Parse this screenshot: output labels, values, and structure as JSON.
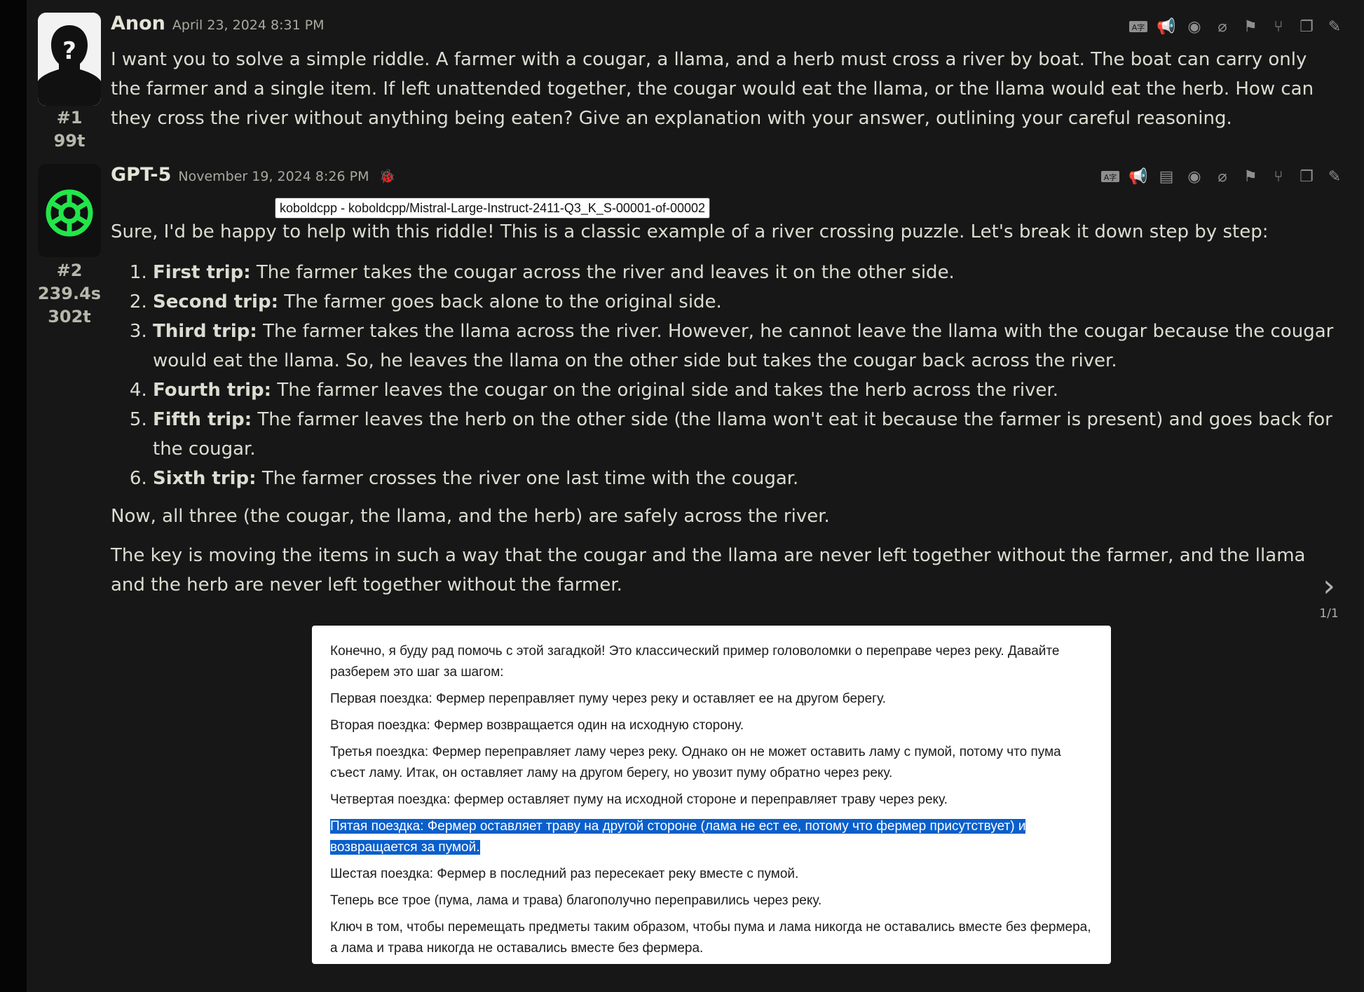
{
  "messages": [
    {
      "name": "Anon",
      "date": "April 23, 2024 8:31 PM",
      "id": "#1",
      "tokens": "99t",
      "text": "I want you to solve a simple riddle. A farmer with a cougar, a llama, and a herb must cross a river by boat. The boat can carry only the farmer and a single item. If left unattended together, the cougar would eat the llama, or the llama would eat the herb. How can they cross the river without anything being eaten? Give an explanation with your answer, outlining your careful reasoning."
    },
    {
      "name": "GPT-5",
      "date": "November 19, 2024 8:26 PM",
      "id": "#2",
      "time": "239.4s",
      "tokens": "302t",
      "intro": "Sure, I'd be happy to help with this riddle! This is a classic example of a river crossing puzzle. Let's break it down step by step:",
      "steps": [
        {
          "label": "First trip:",
          "text": " The farmer takes the cougar across the river and leaves it on the other side."
        },
        {
          "label": "Second trip:",
          "text": " The farmer goes back alone to the original side."
        },
        {
          "label": "Third trip:",
          "text": " The farmer takes the llama across the river. However, he cannot leave the llama with the cougar because the cougar would eat the llama. So, he leaves the llama on the other side but takes the cougar back across the river."
        },
        {
          "label": "Fourth trip:",
          "text": " The farmer leaves the cougar on the original side and takes the herb across the river."
        },
        {
          "label": "Fifth trip:",
          "text": " The farmer leaves the herb on the other side (the llama won't eat it because the farmer is present) and goes back for the cougar."
        },
        {
          "label": "Sixth trip:",
          "text": " The farmer crosses the river one last time with the cougar."
        }
      ],
      "para1": "Now, all three (the cougar, the llama, and the herb) are safely across the river.",
      "para2": "The key is moving the items in such a way that the cougar and the llama are never left together without the farmer, and the llama and the herb are never left together without the farmer."
    }
  ],
  "tooltip": "koboldcpp - koboldcpp/Mistral-Large-Instruct-2411-Q3_K_S-00001-of-00002",
  "swipe_counter": "1/1",
  "translation": [
    "Конечно, я буду рад помочь с этой загадкой! Это классический пример головоломки о переправе через реку. Давайте разберем это шаг за шагом:",
    "Первая поездка: Фермер переправляет пуму через реку и оставляет ее на другом берегу.",
    "Вторая поездка: Фермер возвращается один на исходную сторону.",
    "Третья поездка: Фермер переправляет ламу через реку. Однако он не может оставить ламу с пумой, потому что пума съест ламу. Итак, он оставляет ламу на другом берегу, но увозит пуму обратно через реку.",
    "Четвертая поездка: фермер оставляет пуму на исходной стороне и переправляет траву через реку.",
    "Пятая поездка: Фермер оставляет траву на другой стороне (лама не ест ее, потому что фермер присутствует) и возвращается за пумой.",
    "Шестая поездка: Фермер в последний раз пересекает реку вместе с пумой.",
    "Теперь все трое (пума, лама и трава) благополучно переправились через реку.",
    "Ключ в том, чтобы перемещать предметы таким образом, чтобы пума и лама никогда не оставались вместе без фермера, а лама и трава никогда не оставались вместе без фермера."
  ],
  "icons_msg1": [
    "translate-icon",
    "narrate-icon",
    "hide-icon",
    "attach-icon",
    "checkpoint-icon",
    "branch-icon",
    "copy-icon",
    "edit-icon"
  ],
  "icons_msg2": [
    "translate-icon",
    "narrate-icon",
    "prompt-icon",
    "hide-icon",
    "attach-icon",
    "checkpoint-icon",
    "branch-icon",
    "copy-icon",
    "edit-icon"
  ]
}
